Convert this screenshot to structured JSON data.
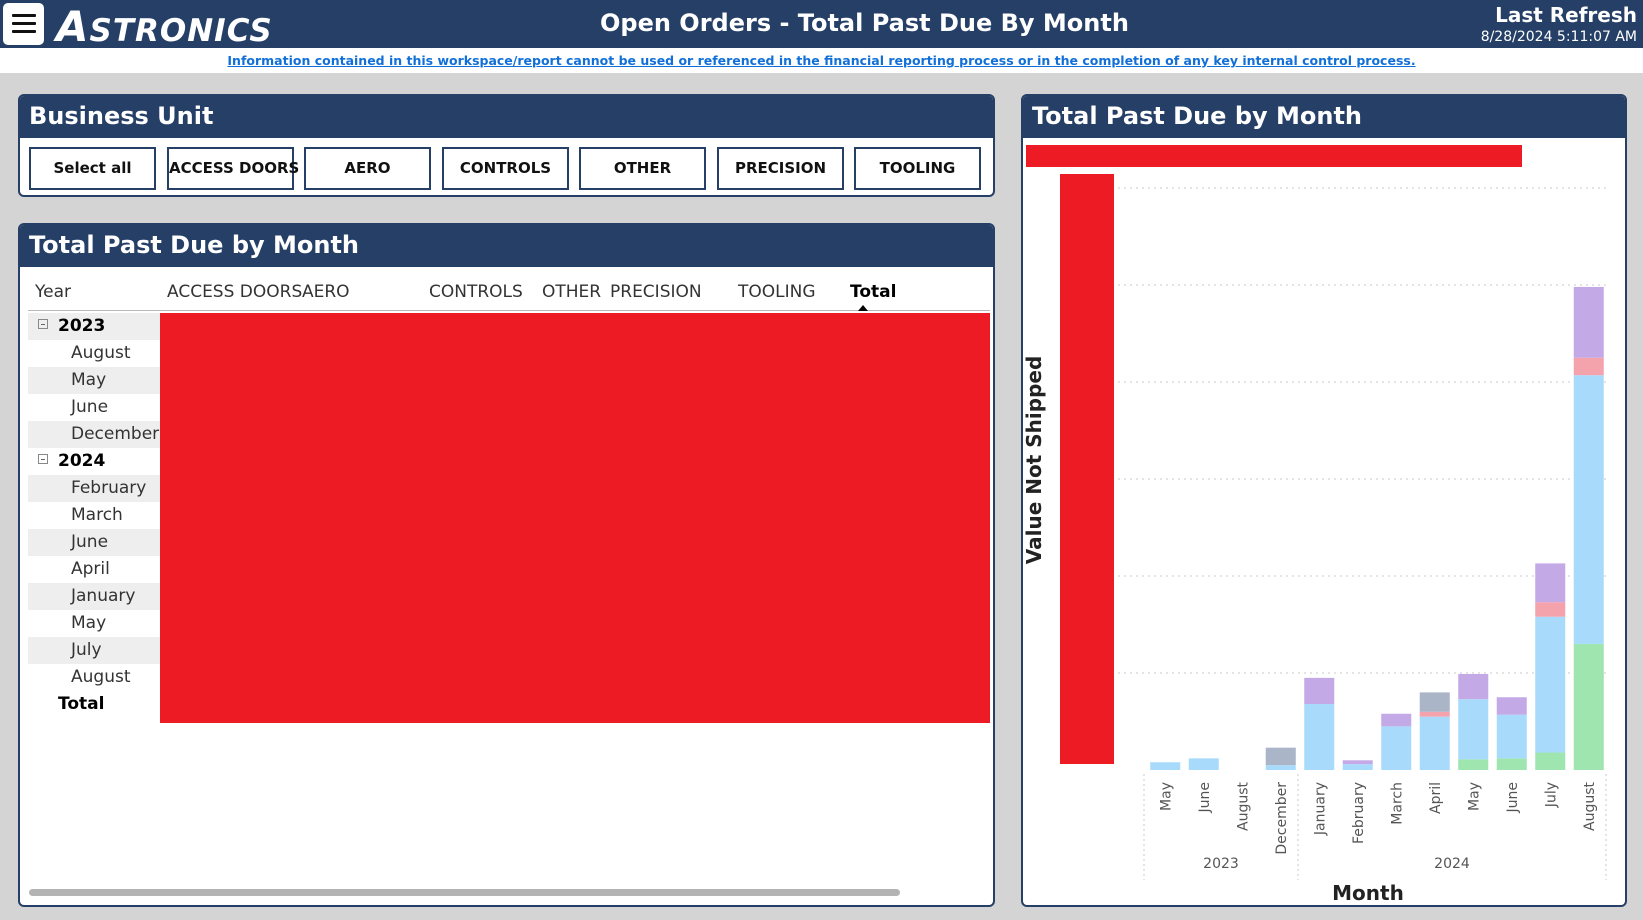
{
  "header": {
    "title": "Open Orders - Total Past Due By Month",
    "logo_first": "A",
    "logo_rest": "STRONICS",
    "last_refresh_label": "Last Refresh",
    "last_refresh_time": "8/28/2024 5:11:07 AM",
    "colors": {
      "bar": "#263f67",
      "redacted": "#ed1c24"
    }
  },
  "notice": "Information contained in this workspace/report cannot be used or referenced in the financial reporting process or in the completion of any key internal control process.",
  "business_unit": {
    "title": "Business Unit",
    "buttons": [
      "Select all",
      "ACCESS DOORS",
      "AERO",
      "CONTROLS",
      "OTHER",
      "PRECISION",
      "TOOLING"
    ]
  },
  "matrix": {
    "title": "Total Past Due by Month",
    "columns": [
      "Year",
      "ACCESS DOORS",
      "AERO",
      "CONTROLS",
      "OTHER",
      "PRECISION",
      "TOOLING",
      "Total"
    ],
    "sorted_column": "Total",
    "rows": [
      {
        "label": "2023",
        "level": "year",
        "expand": "collapse"
      },
      {
        "label": "August",
        "level": "month"
      },
      {
        "label": "May",
        "level": "month"
      },
      {
        "label": "June",
        "level": "month"
      },
      {
        "label": "December",
        "level": "month"
      },
      {
        "label": "2024",
        "level": "year",
        "expand": "collapse"
      },
      {
        "label": "February",
        "level": "month"
      },
      {
        "label": "March",
        "level": "month"
      },
      {
        "label": "June",
        "level": "month"
      },
      {
        "label": "April",
        "level": "month"
      },
      {
        "label": "January",
        "level": "month"
      },
      {
        "label": "May",
        "level": "month"
      },
      {
        "label": "July",
        "level": "month"
      },
      {
        "label": "August",
        "level": "month"
      },
      {
        "label": "Total",
        "level": "total"
      }
    ],
    "values_redacted": true
  },
  "chart_panel": {
    "title": "Total Past Due by Month"
  },
  "chart_data": {
    "type": "bar",
    "stacked": true,
    "ylabel": "Value Not Shipped",
    "xlabel": "Month",
    "y_axis_redacted": true,
    "legend_redacted": true,
    "ylim": [
      0,
      6
    ],
    "grid": true,
    "categories": [
      "May",
      "June",
      "August",
      "December",
      "January",
      "February",
      "March",
      "April",
      "May",
      "June",
      "July",
      "August"
    ],
    "groups": [
      {
        "label": "2023",
        "count": 4
      },
      {
        "label": "2024",
        "count": 8
      }
    ],
    "series": [
      {
        "color": "#9fe5b0",
        "values": [
          0,
          0,
          0,
          0,
          0,
          0,
          0,
          0,
          0.11,
          0.12,
          0.18,
          1.3
        ]
      },
      {
        "color": "#a8dbfb",
        "values": [
          0.08,
          0.12,
          0,
          0.05,
          0.68,
          0.06,
          0.45,
          0.55,
          0.62,
          0.45,
          1.4,
          2.77
        ]
      },
      {
        "color": "#f4a3ad",
        "values": [
          0,
          0,
          0,
          0,
          0,
          0,
          0,
          0.05,
          0,
          0,
          0.15,
          0.18
        ]
      },
      {
        "color": "#aab5c8",
        "values": [
          0,
          0,
          0,
          0.18,
          0,
          0,
          0,
          0.2,
          0,
          0,
          0,
          0
        ]
      },
      {
        "color": "#c4a9e7",
        "values": [
          0,
          0,
          0,
          0,
          0.27,
          0.04,
          0.13,
          0,
          0.26,
          0.18,
          0.4,
          0.73
        ]
      }
    ]
  }
}
